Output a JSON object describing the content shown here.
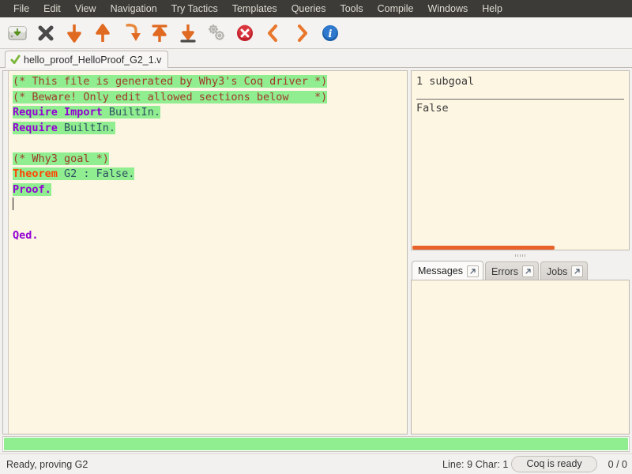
{
  "menu": {
    "items": [
      {
        "label": "File"
      },
      {
        "label": "Edit"
      },
      {
        "label": "View"
      },
      {
        "label": "Navigation"
      },
      {
        "label": "Try Tactics"
      },
      {
        "label": "Templates"
      },
      {
        "label": "Queries"
      },
      {
        "label": "Tools"
      },
      {
        "label": "Compile"
      },
      {
        "label": "Windows"
      },
      {
        "label": "Help"
      }
    ]
  },
  "toolbar": {
    "buttons": [
      {
        "icon": "save-icon",
        "title": "Save"
      },
      {
        "icon": "close-icon",
        "title": "Close"
      },
      {
        "icon": "forward-one-arrow-down-icon",
        "title": "Forward one command"
      },
      {
        "icon": "backward-one-arrow-up-icon",
        "title": "Backward one command"
      },
      {
        "icon": "go-to-cursor-arrow-icon",
        "title": "Go to cursor"
      },
      {
        "icon": "restart-arrow-up-bar-icon",
        "title": "Restart"
      },
      {
        "icon": "go-to-end-arrow-down-bar-icon",
        "title": "Go to end"
      },
      {
        "icon": "gears-icon",
        "title": "Compile"
      },
      {
        "icon": "stop-icon",
        "title": "Interrupt"
      },
      {
        "icon": "previous-chevron-icon",
        "title": "Previous"
      },
      {
        "icon": "next-chevron-icon",
        "title": "Next"
      },
      {
        "icon": "info-icon",
        "title": "About"
      }
    ]
  },
  "file_tab": {
    "label": "hello_proof_HelloProof_G2_1.v",
    "status_icon": "green-check-icon"
  },
  "editor": {
    "lines": [
      {
        "highlight": true,
        "spans": [
          {
            "text": "(* This file is generated by Why3's Coq driver *)",
            "cls": "tok-comment"
          }
        ]
      },
      {
        "highlight": true,
        "spans": [
          {
            "text": "(* Beware! Only edit allowed sections below    *)",
            "cls": "tok-comment"
          }
        ]
      },
      {
        "highlight": true,
        "spans": [
          {
            "text": "Require Import ",
            "cls": "tok-kw"
          },
          {
            "text": "BuiltIn.",
            "cls": "tok-id"
          }
        ]
      },
      {
        "highlight": true,
        "spans": [
          {
            "text": "Require ",
            "cls": "tok-kw"
          },
          {
            "text": "BuiltIn.",
            "cls": "tok-id"
          }
        ]
      },
      {
        "highlight": false,
        "spans": [
          {
            "text": "",
            "cls": ""
          }
        ]
      },
      {
        "highlight": true,
        "spans": [
          {
            "text": "(* Why3 goal *)",
            "cls": "tok-comment"
          }
        ]
      },
      {
        "highlight": true,
        "spans": [
          {
            "text": "Theorem ",
            "cls": "tok-decl"
          },
          {
            "text": "G2 : False.",
            "cls": "tok-id"
          }
        ]
      },
      {
        "highlight": true,
        "spans": [
          {
            "text": "Proof.",
            "cls": "tok-kw"
          }
        ]
      },
      {
        "highlight": false,
        "caret": true,
        "spans": [
          {
            "text": "",
            "cls": ""
          }
        ]
      },
      {
        "highlight": false,
        "spans": [
          {
            "text": "",
            "cls": ""
          }
        ]
      },
      {
        "highlight": false,
        "spans": [
          {
            "text": "Qed.",
            "cls": "tok-kw"
          }
        ]
      }
    ]
  },
  "goal_pane": {
    "header": "1 subgoal",
    "goal": "False",
    "hscroll_percent": 66
  },
  "message_tabs": [
    {
      "label": "Messages",
      "active": true,
      "detach_icon": "detach-arrow-icon"
    },
    {
      "label": "Errors",
      "active": false,
      "detach_icon": "detach-arrow-icon"
    },
    {
      "label": "Jobs",
      "active": false,
      "detach_icon": "detach-arrow-icon"
    }
  ],
  "messages_body": "",
  "progress": {
    "percent": 100,
    "color": "#90ee90"
  },
  "statusbar": {
    "message": "Ready, proving G2",
    "line_char": "Line:   9 Char: 1",
    "coq_status": "Coq is ready",
    "counter": "0 / 0"
  }
}
